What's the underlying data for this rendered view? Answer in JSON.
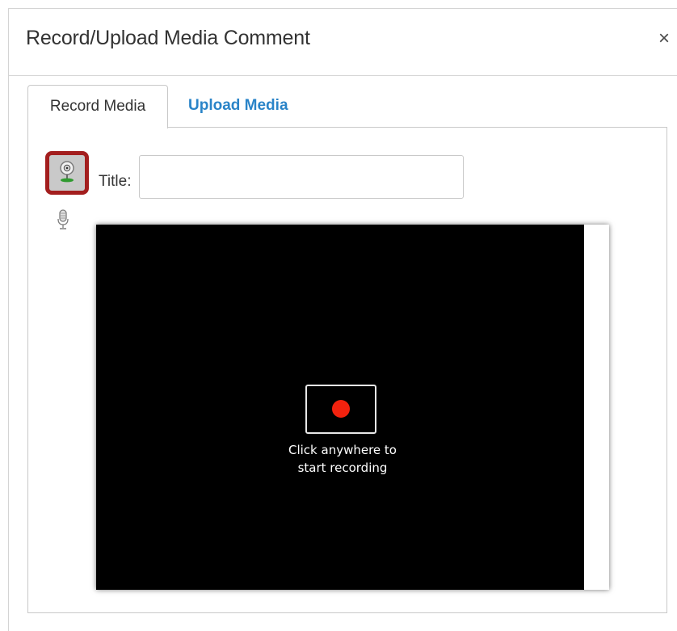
{
  "dialog": {
    "title": "Record/Upload Media Comment",
    "close_label": "×"
  },
  "tabs": [
    {
      "label": "Record Media",
      "active": true
    },
    {
      "label": "Upload Media",
      "active": false
    }
  ],
  "record_panel": {
    "webcam_icon": "webcam-icon",
    "mic_icon": "microphone-icon",
    "title_label": "Title:",
    "title_value": "",
    "recorder": {
      "prompt_line1": "Click anywhere to",
      "prompt_line2": "start recording",
      "record_icon": "record-dot-icon"
    }
  },
  "colors": {
    "tab_link": "#2a84c8",
    "webcam_highlight": "#a31e1e",
    "record_dot": "#f2220e",
    "recorder_background": "#000000"
  }
}
